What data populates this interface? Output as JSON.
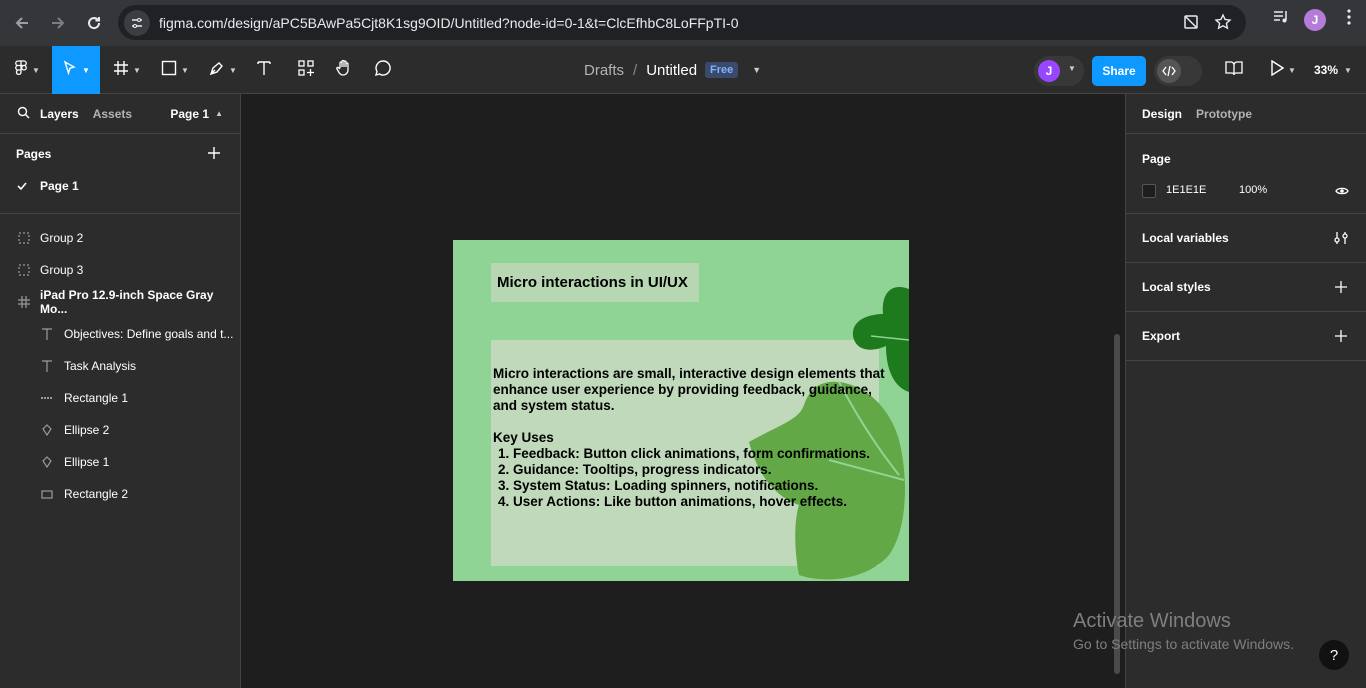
{
  "browser": {
    "url": "figma.com/design/aPC5BAwPa5Cjt8K1sg9OID/Untitled?node-id=0-1&t=ClcEfhbC8LoFFpTI-0",
    "profile_initial": "J"
  },
  "toolbar": {
    "breadcrumb": "Drafts",
    "separator": "/",
    "file_title": "Untitled",
    "plan_badge": "Free",
    "user_initial": "J",
    "share_label": "Share",
    "zoom_label": "33%"
  },
  "left_panel": {
    "tabs": [
      "Layers",
      "Assets"
    ],
    "page_selector": "Page 1",
    "pages_heading": "Pages",
    "current_page": "Page 1",
    "layers": [
      {
        "name": "Group 2",
        "icon": "group-icon",
        "indent": 0
      },
      {
        "name": "Group 3",
        "icon": "group-icon",
        "indent": 0
      },
      {
        "name": "iPad Pro 12.9-inch Space Gray Mo...",
        "icon": "frame-icon",
        "indent": 0
      },
      {
        "name": "Objectives: Define goals and t...",
        "icon": "text-icon",
        "indent": 1
      },
      {
        "name": "Task Analysis",
        "icon": "text-icon",
        "indent": 1
      },
      {
        "name": "Rectangle 1",
        "icon": "rectangle-dashed-icon",
        "indent": 1
      },
      {
        "name": "Ellipse 2",
        "icon": "vector-icon",
        "indent": 1
      },
      {
        "name": "Ellipse 1",
        "icon": "vector-icon",
        "indent": 1
      },
      {
        "name": "Rectangle 2",
        "icon": "rectangle-icon",
        "indent": 1
      }
    ]
  },
  "canvas": {
    "slide_title": "Micro interactions in UI/UX",
    "intro_lines": [
      "Micro interactions are small, interactive design elements that",
      "enhance user experience by providing feedback, guidance,",
      "and system status."
    ],
    "key_uses_heading": "Key Uses",
    "key_uses": [
      "Feedback: Button click animations, form confirmations.",
      "Guidance: Tooltips, progress indicators.",
      "System Status: Loading spinners, notifications.",
      "User Actions: Like button animations, hover effects."
    ]
  },
  "right_panel": {
    "tabs": [
      "Design",
      "Prototype"
    ],
    "page_heading": "Page",
    "page_color": "1E1E1E",
    "page_opacity": "100%",
    "sections": [
      "Local variables",
      "Local styles",
      "Export"
    ]
  },
  "watermark": {
    "title": "Activate Windows",
    "subtitle": "Go to Settings to activate Windows."
  },
  "help_label": "?",
  "colors": {
    "accent": "#0d99ff",
    "frame_bg": "#8fd494",
    "leaf_dark": "#1d7a1d",
    "leaf_light": "#62a847"
  }
}
